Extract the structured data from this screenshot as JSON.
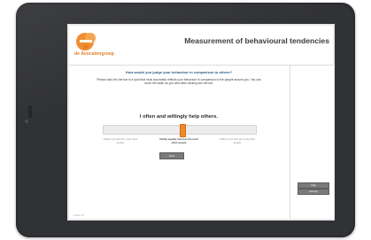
{
  "header": {
    "logo_text": "de Avocatengroep",
    "title": "Measurement of behavioural tendencies"
  },
  "survey": {
    "question": "How would you judge your behaviour in comparison to others?",
    "instructions": "Please click into the bar in a spot that most accurately reflects your behaviour in comparison to the people around you. You can move the slider as you wish after clicking into the bar.",
    "statement": "I often and willingly help others.",
    "slider_value": 0.52,
    "scale_left": "Visibly less than the most other people",
    "scale_center": "Visibly equally much as the most other people",
    "scale_right": "Visibly more than the most other people",
    "next_label": "Next"
  },
  "sidebar": {
    "btn1_label": "Help",
    "btn2_label": "Interrupt"
  },
  "footer": {
    "note": "version 1.0"
  },
  "colors": {
    "accent": "#ef8a2a",
    "heading": "#2c5a8a",
    "button": "#7a7a7a"
  }
}
